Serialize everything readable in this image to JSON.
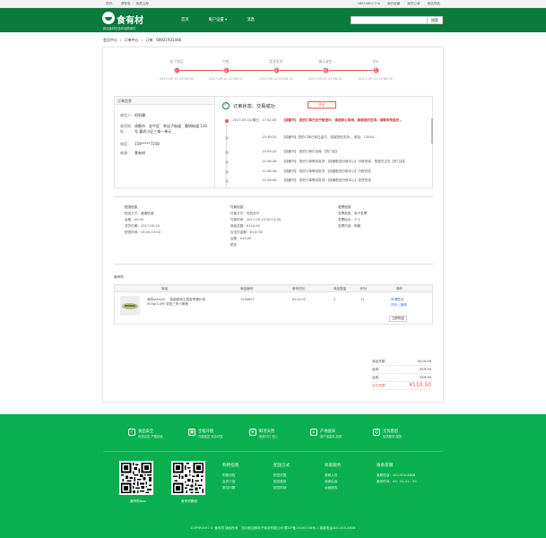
{
  "topbar": {
    "left": [
      "您好，",
      "请登录",
      "免费注册"
    ],
    "right": [
      "18610601178",
      "我的收藏",
      "我的订单",
      "网站导航"
    ]
  },
  "header": {
    "logo_name": "食有材",
    "slogan": "鲜活食材优选有保障食材",
    "nav": [
      "首页",
      "账户设置",
      "消息"
    ],
    "search_placeholder": "",
    "search_button": "搜索"
  },
  "breadcrumb": [
    "会员中心",
    "›",
    "订单中心",
    "›",
    "订单：60921931446"
  ],
  "steps": [
    {
      "label": "拍下商品",
      "num": "✓",
      "time": "2017-09-12  23:50:41"
    },
    {
      "label": "付款",
      "num": "2",
      "time": "2017-09-12  23:50:51"
    },
    {
      "label": "卖家发货",
      "num": "3",
      "time": "2017-09-12  23:50:51"
    },
    {
      "label": "确认收货",
      "num": "4",
      "time": "2017-09-12  23:50:51"
    },
    {
      "label": "评价",
      "num": "5",
      "time": "2017-09-12  23:50:51"
    }
  ],
  "order_info": {
    "title": "订单信息",
    "rows": [
      {
        "k": "收货人：",
        "v": "柯利臻"
      },
      {
        "k": "收货地址：",
        "v": "成都市　金牛区　茶店子街道　蜀明街道 110号 嘉尚小区三栋一单元"
      },
      {
        "k": "电话：",
        "v": "159*****7258"
      },
      {
        "k": "来源：",
        "v": "食有材"
      }
    ]
  },
  "status": {
    "text": "订单状态：交易成功",
    "pay_button": "评价"
  },
  "timeline": [
    {
      "t": "2017-09-10/周日　17:42:05",
      "x": "【成都市】 您的订单已处于配送中，请您耐心等待，感谢您的支持，请联系快递员 。"
    },
    {
      "t": "15:39:25",
      "x": "【成都市】您的订单已到达金牛，感谢您的支持 ，电话：13540..."
    },
    {
      "t": "15:59:25",
      "x": "【成都市】 您的订单已出库 【热门站】"
    },
    {
      "t": "11:56:48",
      "x": "【成都市】 您的订单等待发货 【成都配送分拣中心】分拣完成，快递员正在【热门站】"
    },
    {
      "t": "11:56:48",
      "x": "【成都市】 您的订单等待发货 【成都配送分拣中心】分拣完成"
    },
    {
      "t": "11:56:48",
      "x": "【成都市】 您的订单等待发货 【成都配送分拣中心】发货完成"
    }
  ],
  "delivery": {
    "title": "配送信息",
    "rows": [
      "配送方式：普通快递",
      "运费：¥0.00",
      "送货日期：2017-09-10",
      "配送时间：15:00-19:00"
    ]
  },
  "payment": {
    "title": "付款信息",
    "rows": [
      "付款方式：在线支付",
      "付款时间：2017-09-10 09:13:45",
      "商品总额：¥110.00",
      "应支付金额：¥110.50",
      "运费：¥19.50",
      "更多"
    ]
  },
  "invoice": {
    "title": "发票信息",
    "rows": [
      "发票类型：电子发票",
      "发票抬头：个人",
      "发票内容：明细"
    ]
  },
  "shop_name": "食有材",
  "goods": {
    "headers": [
      "商品",
      "商品编号",
      "食有材价",
      "商品数量",
      "积分",
      "操作"
    ],
    "name": "我的stemlar 　智能厨师主厨智享蛋炒饭 500g/3-4份 双色三条小黄鱼",
    "code": "1234657",
    "price": "¥110.00",
    "qty": "2",
    "points": "11",
    "ops": [
      "申请售后",
      "评价 | 晒单"
    ],
    "buy_again": "立即购买"
  },
  "summary": [
    {
      "k": "商品总额：",
      "v": "¥110.00"
    },
    {
      "k": "返现：",
      "v": "- ¥19.50"
    },
    {
      "k": "运费：",
      "v": "¥19.50"
    },
    {
      "k": "应付总额：",
      "v": "¥110.50"
    }
  ],
  "footer": {
    "features": [
      {
        "label": "食品安全",
        "desc": "商品实拍 严格检验"
      },
      {
        "label": "全程冷链",
        "desc": "冷链配送 安全可靠"
      },
      {
        "label": "鲜活天然",
        "desc": "新鲜可口 放心"
      },
      {
        "label": "产地直采",
        "desc": "原产地直采 品质"
      },
      {
        "label": "无忧售后",
        "desc": "优质服务 保障"
      }
    ],
    "qr_labels": [
      "食有材App",
      "食有材微信"
    ],
    "columns": [
      {
        "h": "购物指南",
        "items": [
          "购物流程",
          "会员介绍",
          "常见问题"
        ]
      },
      {
        "h": "配送方式",
        "items": [
          "配送范围",
          "配送费用",
          "配送时间"
        ]
      },
      {
        "h": "商家服务",
        "items": [
          "商家入驻",
          "商家后台",
          "运营服务"
        ]
      },
      {
        "h": "联系客服",
        "items": [
          "客服电话：400-000-8808",
          "服务时间：09：00-21：00"
        ]
      }
    ],
    "copyright": "COPYRIGHT © 食有材 版权所有　四川鲜活鲜电子商务有限公司 蜀ICP备15000158号-1  客服电话400-000-8808"
  }
}
